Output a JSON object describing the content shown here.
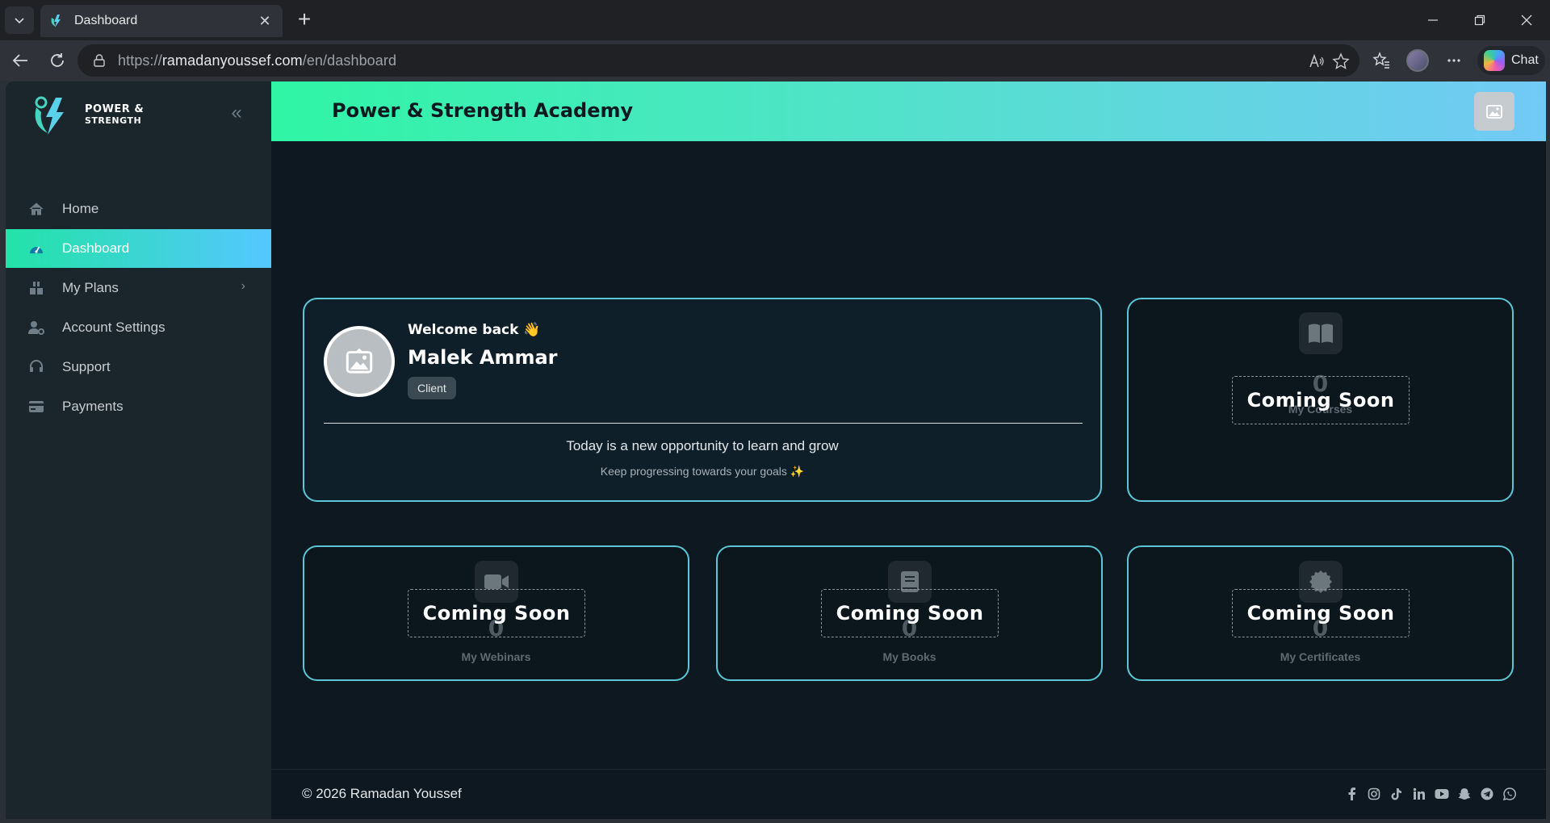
{
  "browser": {
    "tab_title": "Dashboard",
    "url_scheme": "https://",
    "url_host": "ramadanyoussef.com",
    "url_path": "/en/dashboard",
    "chat_label": "Chat"
  },
  "brand": {
    "line1": "POWER &",
    "line2": "STRENGTH"
  },
  "sidebar": {
    "items": [
      {
        "label": "Home",
        "icon": "home-icon"
      },
      {
        "label": "Dashboard",
        "icon": "dashboard-gauge-icon",
        "active": true
      },
      {
        "label": "My Plans",
        "icon": "plans-icon",
        "has_submenu": true
      },
      {
        "label": "Account Settings",
        "icon": "user-gear-icon"
      },
      {
        "label": "Support",
        "icon": "headset-icon"
      },
      {
        "label": "Payments",
        "icon": "credit-card-icon"
      }
    ]
  },
  "header": {
    "title": "Power & Strength Academy"
  },
  "welcome": {
    "greeting": "Welcome back 👋",
    "name": "Malek Ammar",
    "role": "Client",
    "message": "Today is a new opportunity to learn and grow",
    "submessage": "Keep progressing towards your goals ✨"
  },
  "stats": [
    {
      "label": "My Courses",
      "value": "0",
      "overlay": "Coming Soon",
      "icon": "book-open-icon"
    },
    {
      "label": "My Webinars",
      "value": "0",
      "overlay": "Coming Soon",
      "icon": "video-camera-icon"
    },
    {
      "label": "My Books",
      "value": "0",
      "overlay": "Coming Soon",
      "icon": "book-icon"
    },
    {
      "label": "My Certificates",
      "value": "0",
      "overlay": "Coming Soon",
      "icon": "certificate-icon"
    }
  ],
  "footer": {
    "copyright": "© 2026  Ramadan Youssef",
    "socials": [
      "facebook-icon",
      "instagram-icon",
      "tiktok-icon",
      "linkedin-icon",
      "youtube-icon",
      "snapchat-icon",
      "telegram-icon",
      "whatsapp-icon"
    ]
  },
  "colors": {
    "accent_start": "#22e3a6",
    "accent_end": "#55c7ff",
    "card_border": "#5bc7d6",
    "page_bg": "#0d1820"
  }
}
